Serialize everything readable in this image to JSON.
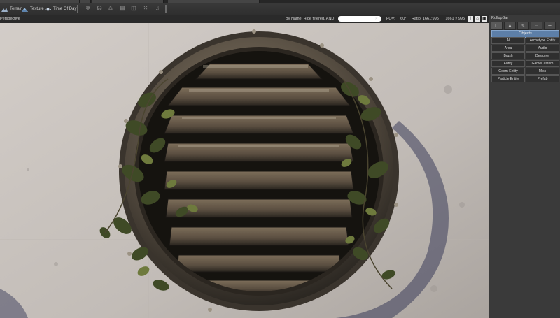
{
  "toolbar": {
    "buttons": [
      {
        "label": "Terrain",
        "icon": "terrain-icon"
      },
      {
        "label": "Texture",
        "icon": "texture-icon"
      },
      {
        "label": "Time Of Day",
        "icon": "time-of-day-icon"
      }
    ],
    "icons": [
      "physics-icon",
      "ai-walk-icon",
      "character-icon",
      "database-icon",
      "flowgraph-icon",
      "particles-icon",
      "audio-icon"
    ]
  },
  "viewport": {
    "view_mode": "Perspective",
    "filter_label": "By Name, Hide filtered, AND",
    "search_value": "",
    "fov_label": "FOV:",
    "fov_value": "60°",
    "ratio_label": "Ratio: 1661:995",
    "resolution": "1661 × 995",
    "header_icons": [
      "info-icon",
      "maximize-icon",
      "layout-icon"
    ]
  },
  "panel": {
    "title": "RollupBar",
    "tabs": [
      "objects-tab-icon",
      "terrain-tab-icon",
      "modify-tab-icon",
      "display-tab-icon",
      "layers-tab-icon"
    ],
    "category": "Objects",
    "items": [
      "AI",
      "Archetype Entity",
      "Area",
      "Audio",
      "Brush",
      "Designer",
      "Entity",
      "GameCustom",
      "Geom Entity",
      "Misc",
      "Particle Entity",
      "Prefab"
    ]
  },
  "colors": {
    "accent": "#5d7fa8",
    "panel_bg": "#3a3a3a",
    "toolbar_bg": "#333333",
    "wall": "#c4beb9"
  }
}
